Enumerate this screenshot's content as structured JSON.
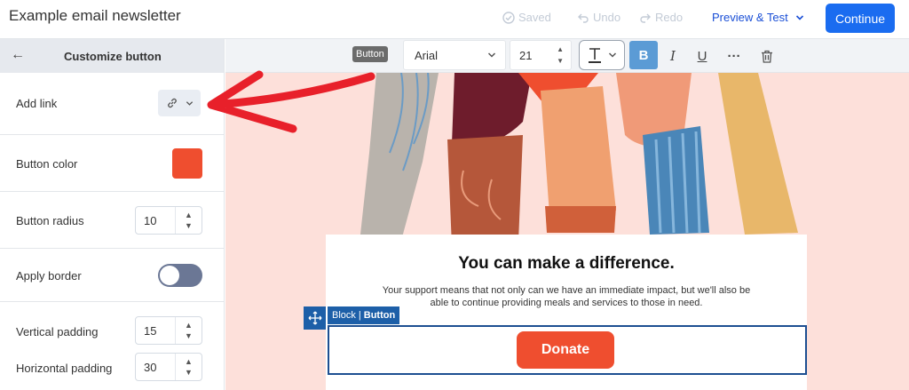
{
  "app": {
    "title": "Example email newsletter"
  },
  "header": {
    "saved": "Saved",
    "undo": "Undo",
    "redo": "Redo",
    "preview": "Preview & Test",
    "continue": "Continue"
  },
  "sidebar": {
    "title": "Customize button",
    "add_link": "Add link",
    "button_color": "Button color",
    "button_color_value": "#ef4e2f",
    "button_radius": "Button radius",
    "button_radius_value": "10",
    "apply_border": "Apply border",
    "apply_border_on": false,
    "vertical_padding": "Vertical padding",
    "vertical_padding_value": "15",
    "horizontal_padding": "Horizontal padding",
    "horizontal_padding_value": "30"
  },
  "toolbar": {
    "badge": "Button",
    "font": "Arial",
    "font_size": "21",
    "bold": "B",
    "italic": "I",
    "underline": "U",
    "more": "···"
  },
  "email": {
    "headline": "You can make a difference.",
    "body": "Your support means that not only can we have an immediate impact, but we'll also be able to continue providing meals and services to those in need.",
    "block_label": "Block",
    "button_label": "Button",
    "donate": "Donate"
  },
  "colors": {
    "accent": "#1a6cf0",
    "donate": "#ef4e2f",
    "canvas_bg": "#fde0da",
    "annotation_arrow": "#e8202a"
  }
}
